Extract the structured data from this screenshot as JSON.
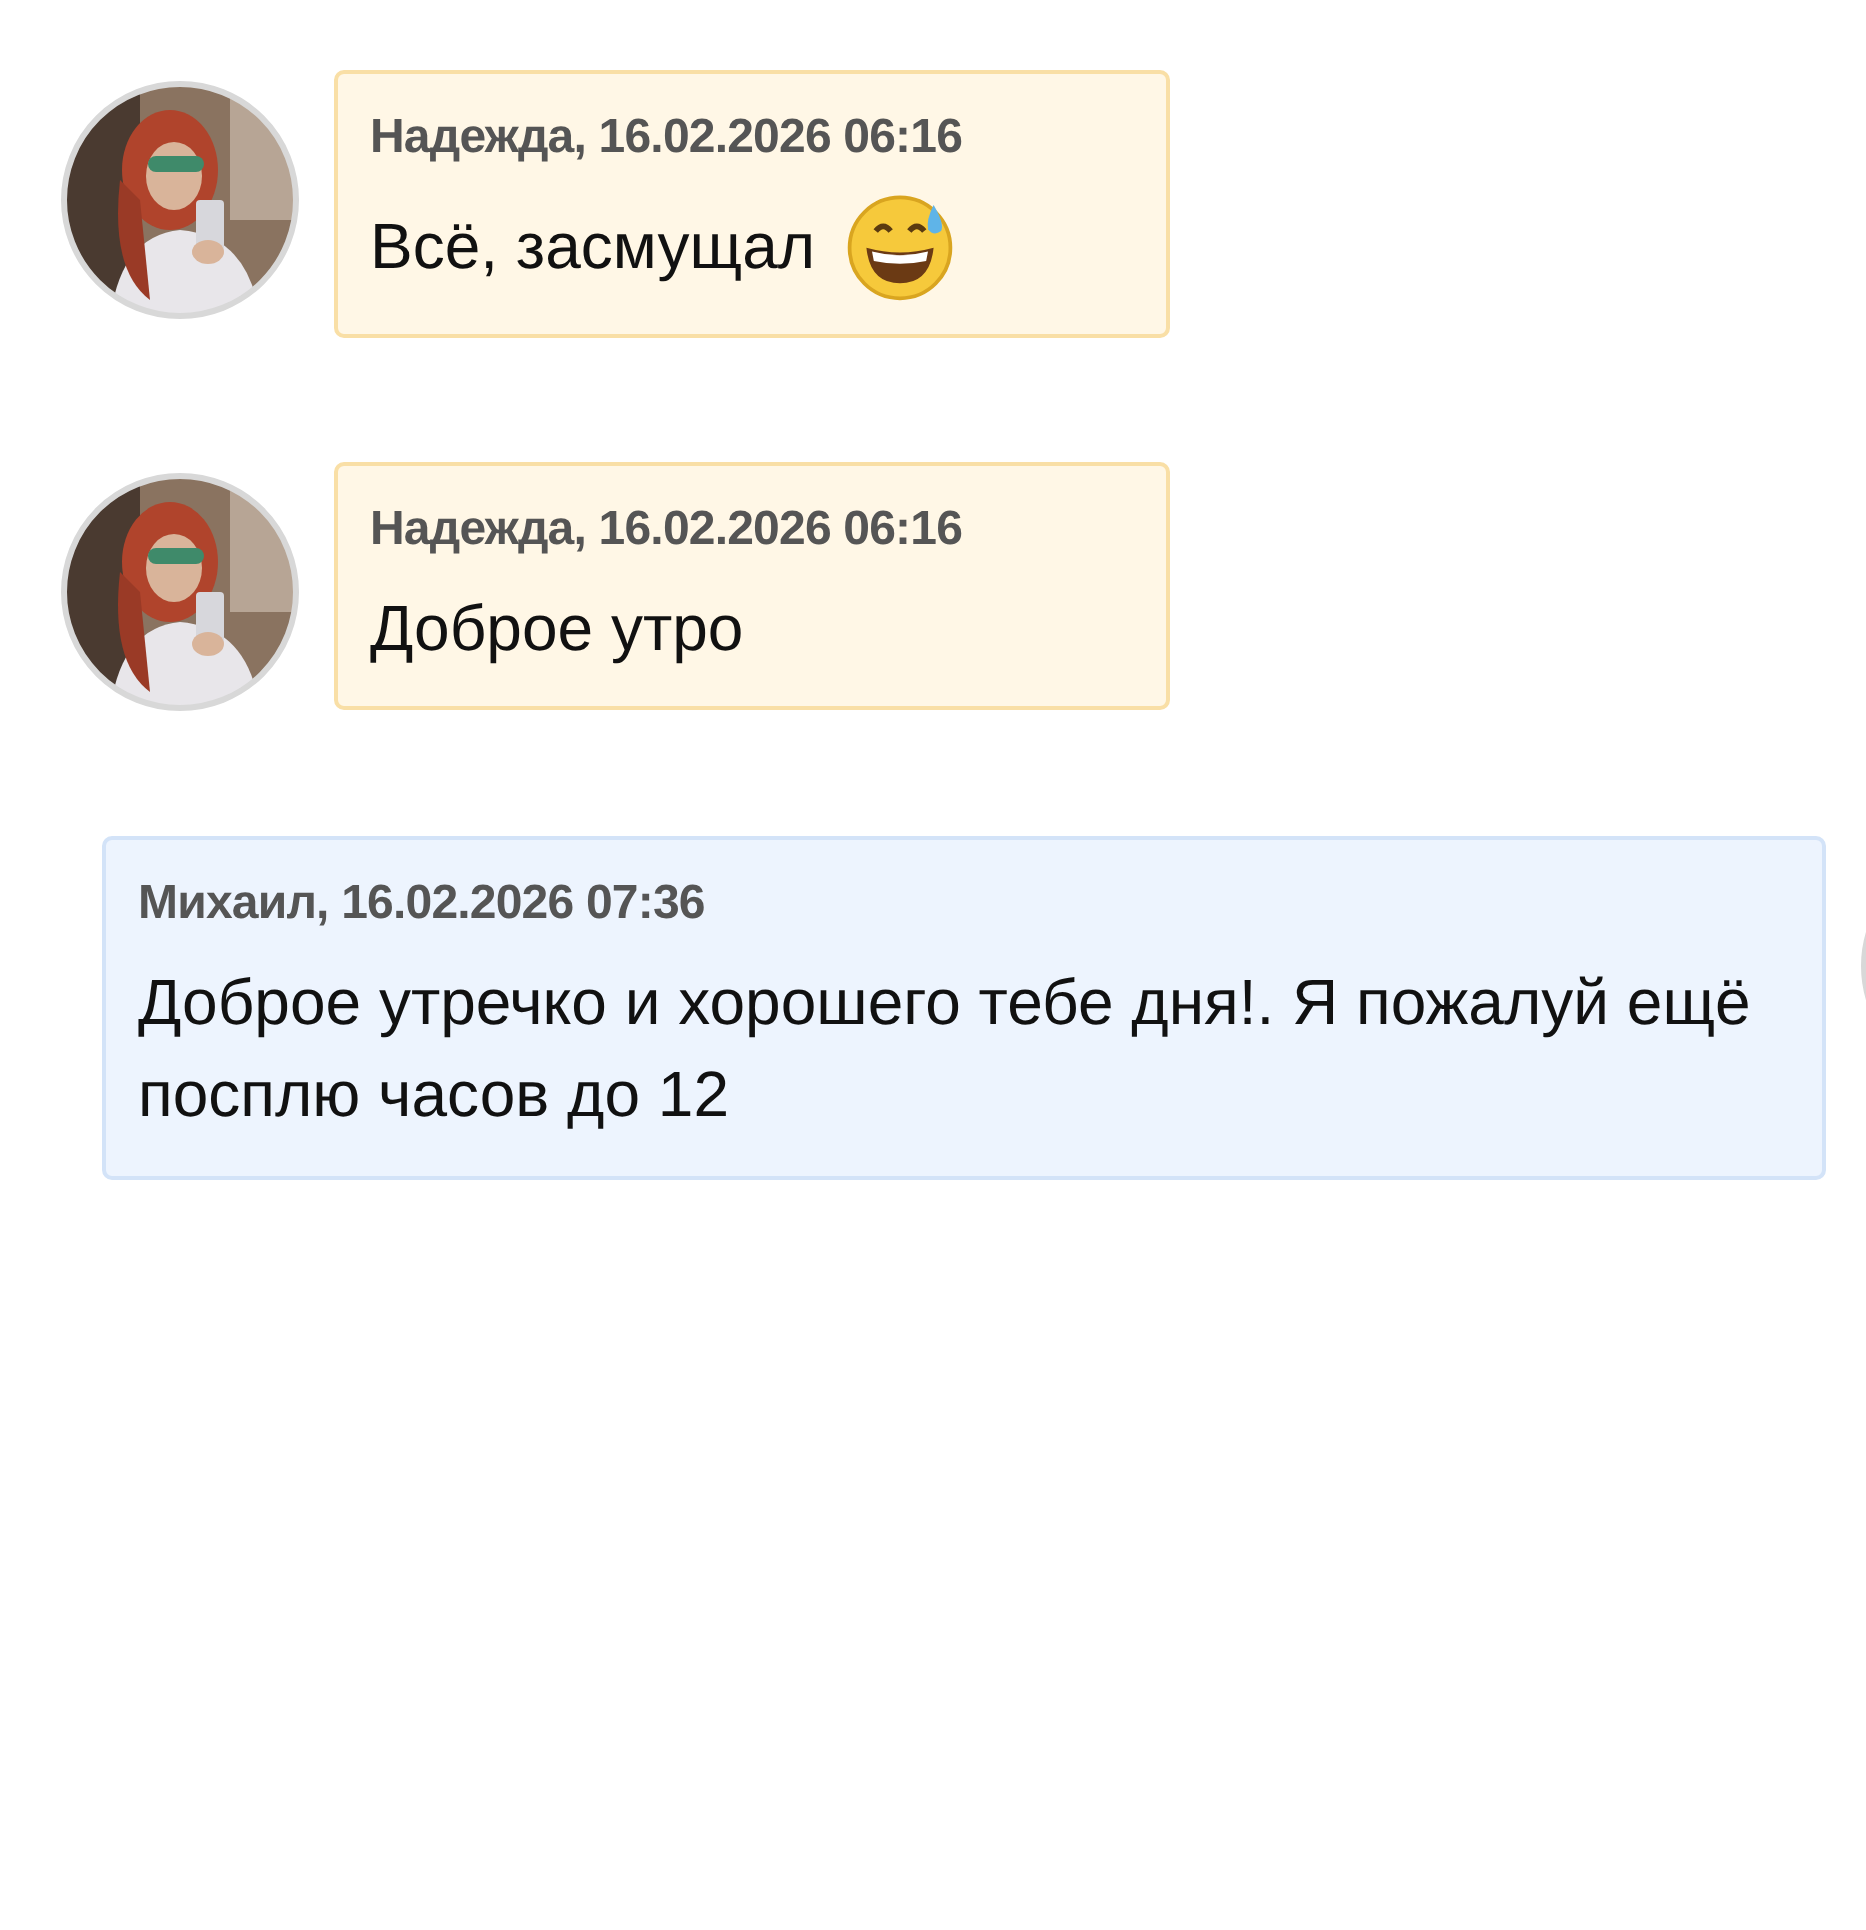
{
  "messages": [
    {
      "kind": "incoming",
      "header": "Надежда, 16.02.2026 06:16",
      "text": "Всё, засмущал",
      "has_emoji": true
    },
    {
      "kind": "incoming",
      "header": "Надежда, 16.02.2026 06:16",
      "text": "Доброе утро",
      "has_emoji": false
    },
    {
      "kind": "outgoing",
      "header": "Михаил, 16.02.2026 07:36",
      "text": "Доброе утречко и хорошего тебе дня!. Я пожалуй ещё посплю часов до 12",
      "has_emoji": false
    }
  ]
}
